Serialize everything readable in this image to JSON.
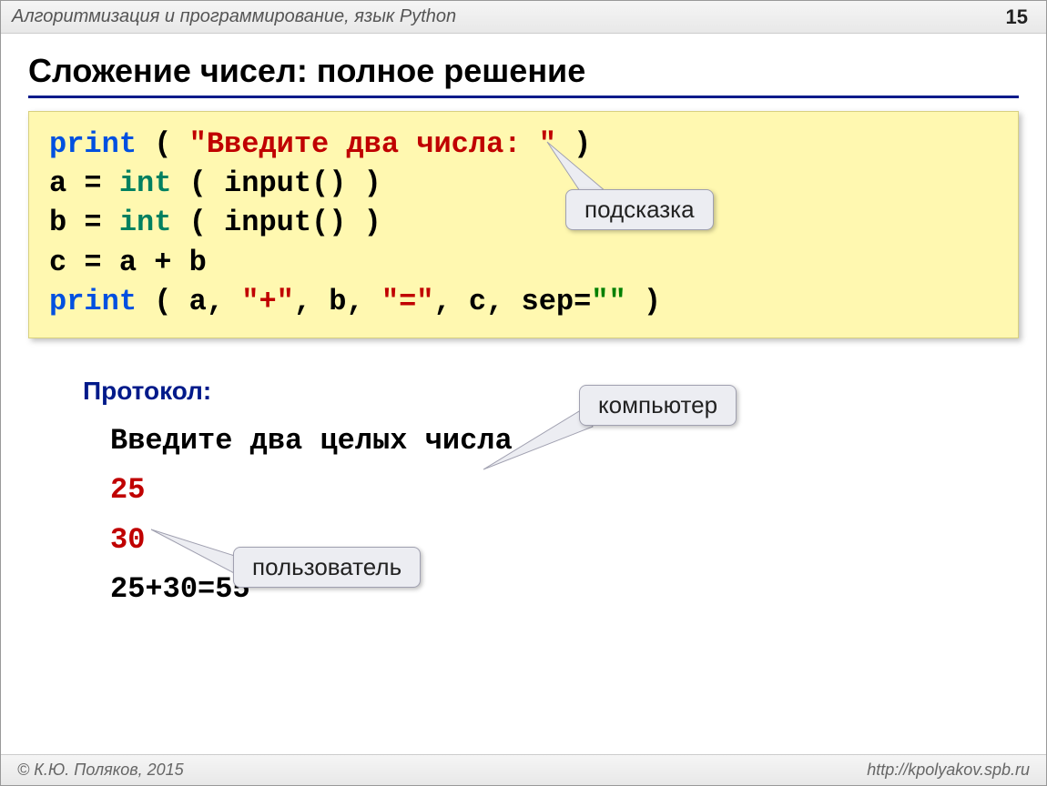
{
  "header": {
    "course": "Алгоритмизация и программирование,  язык Python",
    "page": "15"
  },
  "title": "Сложение чисел: полное решение",
  "code": {
    "print1_kw": "print",
    "print1_open": " ( ",
    "print1_str": "\"Введите два числа: \"",
    "print1_close": " )",
    "line2_a": "a = ",
    "line2_int": "int",
    "line2_rest": " ( input() )",
    "line3_b": "b = ",
    "line3_int": "int",
    "line3_rest": " ( input() )",
    "line4": "c = a + b",
    "print2_kw": "print",
    "print2_open": " ( a, ",
    "print2_s1": "\"+\"",
    "print2_mid1": ", b, ",
    "print2_s2": "\"=\"",
    "print2_mid2": ", c, sep=",
    "print2_s3": "\"\"",
    "print2_close": " )"
  },
  "callouts": {
    "hint": "подсказка",
    "computer": "компьютер",
    "user": "пользователь"
  },
  "protocol": {
    "label": "Протокол:",
    "prompt": "Введите два целых числа",
    "in1": "25",
    "in2": "30",
    "out": "25+30=55"
  },
  "footer": {
    "left": "© К.Ю. Поляков, 2015",
    "right": "http://kpolyakov.spb.ru"
  }
}
